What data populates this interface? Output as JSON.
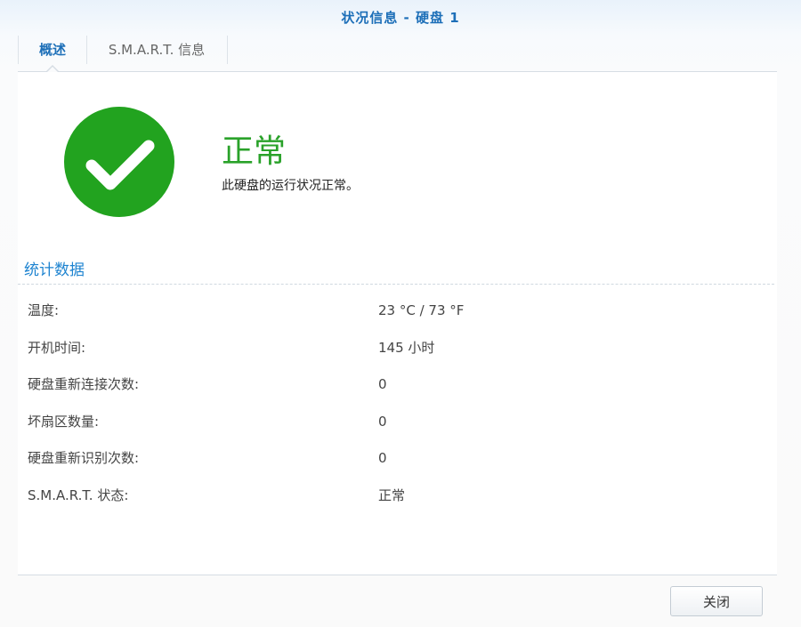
{
  "window": {
    "title": "状况信息 - 硬盘 1"
  },
  "tabs": [
    {
      "label": "概述",
      "active": true
    },
    {
      "label": "S.M.A.R.T. 信息",
      "active": false
    }
  ],
  "status": {
    "icon": "checkmark-circle-icon",
    "title": "正常",
    "description": "此硬盘的运行状况正常。",
    "color": "#2aa22a"
  },
  "statistics": {
    "section_title": "统计数据",
    "rows": [
      {
        "label": "温度:",
        "value": "23 °C / 73 °F"
      },
      {
        "label": "开机时间:",
        "value": "145 小时"
      },
      {
        "label": "硬盘重新连接次数:",
        "value": "0"
      },
      {
        "label": "坏扇区数量:",
        "value": "0"
      },
      {
        "label": "硬盘重新识别次数:",
        "value": "0"
      },
      {
        "label": "S.M.A.R.T. 状态:",
        "value": "正常"
      }
    ]
  },
  "footer": {
    "close_label": "关闭"
  },
  "colors": {
    "accent": "#1d6fb8",
    "section_title": "#1d83d0",
    "ok_green": "#2aa22a"
  }
}
